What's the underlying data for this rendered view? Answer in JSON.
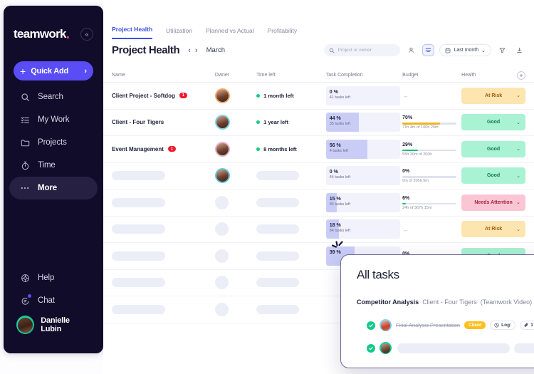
{
  "sidebar": {
    "logo": "teamwork",
    "logo_dot": ".",
    "collapse_icon": "«",
    "quick_add": {
      "label": "Quick Add",
      "plus": "+",
      "chevron": "›"
    },
    "items": [
      {
        "label": "Search",
        "icon": "search-icon",
        "active": false
      },
      {
        "label": "My Work",
        "icon": "list-icon",
        "active": false
      },
      {
        "label": "Projects",
        "icon": "folder-icon",
        "active": false
      },
      {
        "label": "Time",
        "icon": "stopwatch-icon",
        "active": false
      },
      {
        "label": "More",
        "icon": "ellipsis-icon",
        "active": true
      }
    ],
    "bottom": [
      {
        "label": "Help",
        "icon": "help-icon"
      },
      {
        "label": "Chat",
        "icon": "chat-icon"
      }
    ],
    "user": {
      "name": "Danielle Lubin"
    }
  },
  "header": {
    "tabs": [
      {
        "label": "Project Health",
        "active": true
      },
      {
        "label": "Utilization",
        "active": false
      },
      {
        "label": "Planned vs Actual",
        "active": false
      },
      {
        "label": "Profitability",
        "active": false
      }
    ],
    "title": "Project Health",
    "prev_icon": "‹",
    "next_icon": "›",
    "month": "March"
  },
  "toolbar": {
    "search_placeholder": "Project or owner",
    "search_value": "",
    "people_icon": "person-icon",
    "view_icon": "table-view-icon",
    "date_label": "Last month",
    "date_chevron": "⌄",
    "filter_icon": "filter-icon",
    "download_icon": "download-icon"
  },
  "table": {
    "columns": [
      "Name",
      "Owner",
      "Time left",
      "Task Completion",
      "Budget",
      "Health"
    ],
    "add_column_icon": "+",
    "rows": [
      {
        "name": "Client Project - Softdog",
        "badge": "1",
        "owner_color": "#f0a868",
        "owner_skeleton": false,
        "time_left": "1 month left",
        "task_pct": "0 %",
        "task_fill": 0,
        "tasks_left": "41 tasks left",
        "budget_pct": "",
        "budget_fill": 0,
        "budget_sub": "",
        "budget_dash": "–",
        "health": "At Risk",
        "health_class": "h-risk",
        "name_skeleton": false
      },
      {
        "name": "Client - Four Tigers",
        "badge": "",
        "owner_color": "#7ed3e8",
        "owner_skeleton": false,
        "time_left": "1 year left",
        "task_pct": "44 %",
        "task_fill": 44,
        "tasks_left": "35 tasks left",
        "budget_pct": "70%",
        "budget_fill": 70,
        "budget_sub": "71h 4m of 100h 25m",
        "budget_color": "#f2b319",
        "health": "Good",
        "health_class": "h-good",
        "name_skeleton": false
      },
      {
        "name": "Event Management",
        "badge": "1",
        "owner_color": "#e0b4c8",
        "owner_skeleton": false,
        "time_left": "8 months left",
        "task_pct": "56 %",
        "task_fill": 56,
        "tasks_left": "4 tasks left",
        "budget_pct": "29%",
        "budget_fill": 29,
        "budget_sub": "55h 30m of 200h",
        "budget_color": "#13c07a",
        "health": "Good",
        "health_class": "h-good",
        "name_skeleton": false
      },
      {
        "name": "",
        "badge": "",
        "owner_color": "#5ec8e0",
        "owner_skeleton": false,
        "time_left": "",
        "task_pct": "0 %",
        "task_fill": 0,
        "tasks_left": "44 tasks left",
        "budget_pct": "0%",
        "budget_fill": 0,
        "budget_sub": "0m of 205h 5m",
        "budget_color": "#13c07a",
        "health": "Good",
        "health_class": "h-good",
        "name_skeleton": true
      },
      {
        "name": "",
        "badge": "",
        "owner_skeleton": true,
        "time_left": "",
        "task_pct": "15 %",
        "task_fill": 15,
        "tasks_left": "84 tasks left",
        "budget_pct": "6%",
        "budget_fill": 6,
        "budget_sub": "24h of 367h 15m",
        "budget_color": "#13c07a",
        "health": "Needs Attention",
        "health_class": "h-attn",
        "name_skeleton": true
      },
      {
        "name": "",
        "badge": "",
        "owner_skeleton": true,
        "time_left": "",
        "task_pct": "18 %",
        "task_fill": 18,
        "tasks_left": "84 tasks left",
        "budget_pct": "",
        "budget_fill": 0,
        "budget_sub": "",
        "budget_dash": "–",
        "health": "At Risk",
        "health_class": "h-risk",
        "name_skeleton": true
      },
      {
        "name": "",
        "badge": "",
        "owner_skeleton": true,
        "time_left": "",
        "task_pct": "39 %",
        "task_fill": 39,
        "tasks_left": "",
        "budget_pct": "0%",
        "budget_fill": 0,
        "budget_sub": "",
        "health": "Good",
        "health_class": "h-good",
        "name_skeleton": true
      },
      {
        "name": "",
        "badge": "",
        "owner_skeleton": true,
        "time_left": "",
        "task_pct": "",
        "task_fill": 0,
        "tasks_left": "",
        "budget_pct": "",
        "budget_fill": 0,
        "budget_sub": "",
        "health": "",
        "health_class": "",
        "name_skeleton": true
      },
      {
        "name": "",
        "badge": "",
        "owner_skeleton": true,
        "time_left": "",
        "task_pct": "",
        "task_fill": 0,
        "tasks_left": "",
        "budget_pct": "",
        "budget_fill": 0,
        "budget_sub": "",
        "health": "",
        "health_class": "",
        "name_skeleton": true
      }
    ]
  },
  "overlay": {
    "title": "All tasks",
    "project_bold": "Competitor Analysis",
    "project_client": "Client - Four Tigers",
    "project_paren": "(Teamwork Video)",
    "more_icon": "···",
    "task": {
      "name": "Final Analysis Presentation",
      "tag": "Client",
      "log_label": "Log:",
      "log_icon": "clock-icon",
      "attach_icon": "paperclip-icon",
      "attach_count": "1"
    }
  },
  "colors": {
    "brand_purple": "#5a4df5",
    "brand_pink": "#ff3b7f",
    "sidebar_bg": "#100c2a",
    "tab_active": "#3b50df",
    "good": "#a9f2d3",
    "at_risk": "#fde5b0",
    "needs_attention": "#fbc6d4",
    "badge_red": "#f0192f",
    "check_green": "#17c98a",
    "tag_yellow": "#ffc01f"
  }
}
